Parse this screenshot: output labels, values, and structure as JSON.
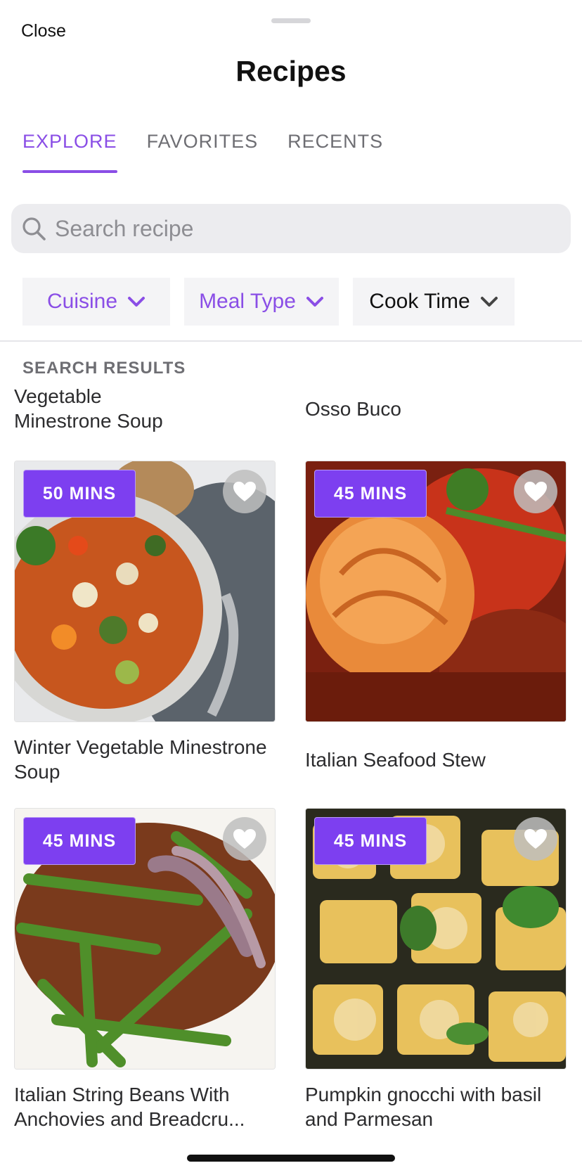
{
  "header": {
    "close_label": "Close",
    "title": "Recipes"
  },
  "tabs": [
    {
      "label": "EXPLORE",
      "active": true
    },
    {
      "label": "FAVORITES",
      "active": false
    },
    {
      "label": "RECENTS",
      "active": false
    }
  ],
  "search": {
    "placeholder": "Search recipe",
    "value": ""
  },
  "filters": [
    {
      "label": "Cuisine",
      "active": true
    },
    {
      "label": "Meal Type",
      "active": true
    },
    {
      "label": "Cook Time",
      "active": false
    }
  ],
  "results": {
    "section_label": "SEARCH RESULTS",
    "previous_titles": [
      "Vegetable\nMinestrone Soup",
      "Osso Buco"
    ],
    "cards": [
      {
        "time": "50 MINS",
        "title": "Winter Vegetable Minestrone Soup",
        "image": "minestrone-soup"
      },
      {
        "time": "45 MINS",
        "title": "Italian Seafood Stew",
        "image": "seafood-stew"
      },
      {
        "time": "45 MINS",
        "title": "Italian String Beans With Anchovies and Breadcru...",
        "image": "string-beans"
      },
      {
        "time": "45 MINS",
        "title": "Pumpkin gnocchi with basil and Parmesan",
        "image": "pumpkin-gnocchi"
      }
    ]
  },
  "colors": {
    "accent": "#8a4ee6",
    "badge": "#7d3ff0",
    "search_bg": "#ececef",
    "filter_bg": "#f4f4f6"
  },
  "icons": {
    "search": "search-icon",
    "chevron": "chevron-down-icon",
    "favorite": "heart-icon"
  }
}
